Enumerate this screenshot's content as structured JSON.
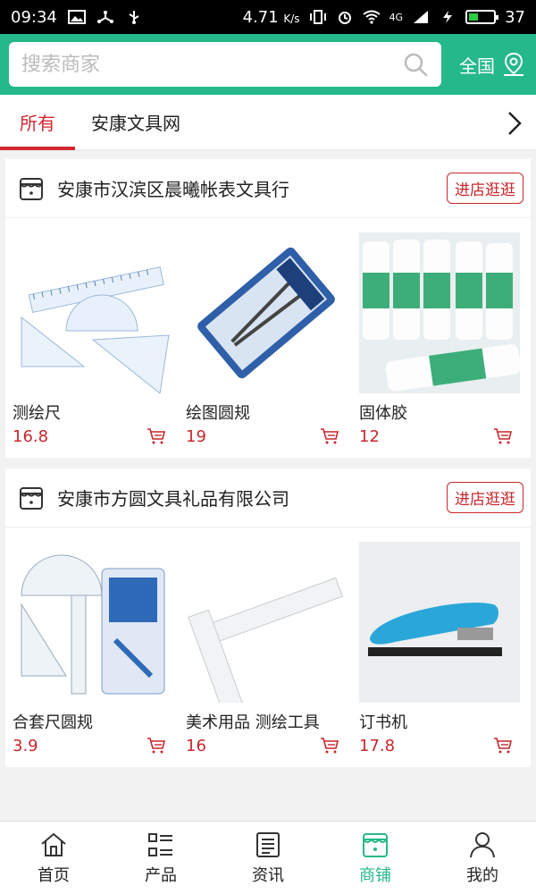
{
  "status": {
    "time": "09:34",
    "speed": "4.71",
    "speed_unit": "K/s",
    "network": "4G",
    "battery": "37"
  },
  "search": {
    "placeholder": "搜索商家",
    "region": "全国"
  },
  "tabs": [
    {
      "label": "所有",
      "active": true
    },
    {
      "label": "安康文具网",
      "active": false
    }
  ],
  "shops": [
    {
      "name": "安康市汉滨区晨曦帐表文具行",
      "enter_label": "进店逛逛",
      "products": [
        {
          "name": "测绘尺",
          "price": "16.8",
          "icon": "ruler-set-image"
        },
        {
          "name": "绘图圆规",
          "price": "19",
          "icon": "compass-set-image"
        },
        {
          "name": "固体胶",
          "price": "12",
          "icon": "glue-stick-image"
        }
      ]
    },
    {
      "name": "安康市方圆文具礼品有限公司",
      "enter_label": "进店逛逛",
      "products": [
        {
          "name": "合套尺圆规",
          "price": "3.9",
          "icon": "ruler-compass-set-image"
        },
        {
          "name": "美术用品 测绘工具",
          "price": "16",
          "icon": "t-square-image"
        },
        {
          "name": "订书机",
          "price": "17.8",
          "icon": "stapler-image"
        }
      ]
    }
  ],
  "bottom_nav": [
    {
      "label": "首页",
      "icon": "home-icon",
      "active": false
    },
    {
      "label": "产品",
      "icon": "list-icon",
      "active": false
    },
    {
      "label": "资讯",
      "icon": "news-icon",
      "active": false
    },
    {
      "label": "商铺",
      "icon": "store-icon",
      "active": true
    },
    {
      "label": "我的",
      "icon": "user-icon",
      "active": false
    }
  ],
  "colors": {
    "brand": "#25b88a",
    "accent_red": "#c8272d"
  }
}
